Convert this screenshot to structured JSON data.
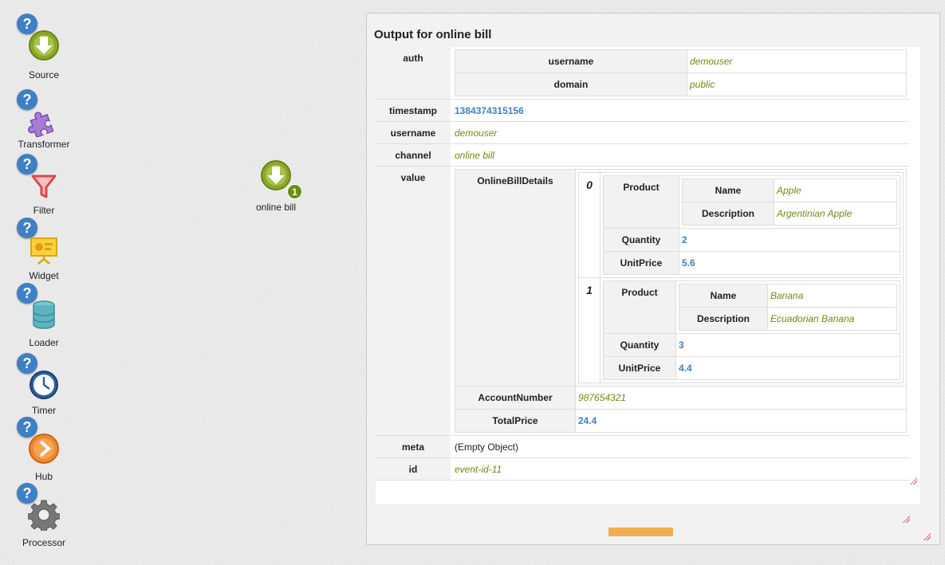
{
  "palette": {
    "items": [
      {
        "label": "Source",
        "icon": "source-icon",
        "color": "#8aa72a"
      },
      {
        "label": "Transformer",
        "icon": "puzzle-icon",
        "color": "#9b6cc9"
      },
      {
        "label": "Filter",
        "icon": "funnel-icon",
        "color": "#e1464a"
      },
      {
        "label": "Widget",
        "icon": "presentation-icon",
        "color": "#f1c40f"
      },
      {
        "label": "Loader",
        "icon": "database-icon",
        "color": "#4aa9b5"
      },
      {
        "label": "Timer",
        "icon": "clock-icon",
        "color": "#2c5fa0"
      },
      {
        "label": "Hub",
        "icon": "hub-icon",
        "color": "#f0892e"
      },
      {
        "label": "Processor",
        "icon": "gear-icon",
        "color": "#666666"
      }
    ],
    "help_glyph": "?"
  },
  "canvas_node": {
    "label": "online bill",
    "badge": "1",
    "icon": "source-icon"
  },
  "panel": {
    "title": "Output for online bill",
    "rows": {
      "auth": {
        "key": "auth",
        "username_key": "username",
        "username_val": "demouser",
        "domain_key": "domain",
        "domain_val": "public"
      },
      "timestamp": {
        "key": "timestamp",
        "val": "1384374315156"
      },
      "username": {
        "key": "username",
        "val": "demouser"
      },
      "channel": {
        "key": "channel",
        "val": "online bill"
      },
      "value": {
        "key": "value",
        "obd_key": "OnlineBillDetails",
        "items": [
          {
            "index": "0",
            "product_key": "Product",
            "name_key": "Name",
            "name_val": "Apple",
            "desc_key": "Description",
            "desc_val": "Argentinian Apple",
            "qty_key": "Quantity",
            "qty_val": "2",
            "price_key": "UnitPrice",
            "price_val": "5.6"
          },
          {
            "index": "1",
            "product_key": "Product",
            "name_key": "Name",
            "name_val": "Banana",
            "desc_key": "Description",
            "desc_val": "Ecuadorian Banana",
            "qty_key": "Quantity",
            "qty_val": "3",
            "price_key": "UnitPrice",
            "price_val": "4.4"
          }
        ],
        "account_key": "AccountNumber",
        "account_val": "987654321",
        "total_key": "TotalPrice",
        "total_val": "24.4"
      },
      "meta": {
        "key": "meta",
        "val": "(Empty Object)"
      },
      "id": {
        "key": "id",
        "val": "event-id-11"
      }
    }
  },
  "colors": {
    "string": "#6a8d12",
    "number": "#3f7fc4",
    "help": "#3f7fc4",
    "ok_button": "#f0ad4e"
  }
}
